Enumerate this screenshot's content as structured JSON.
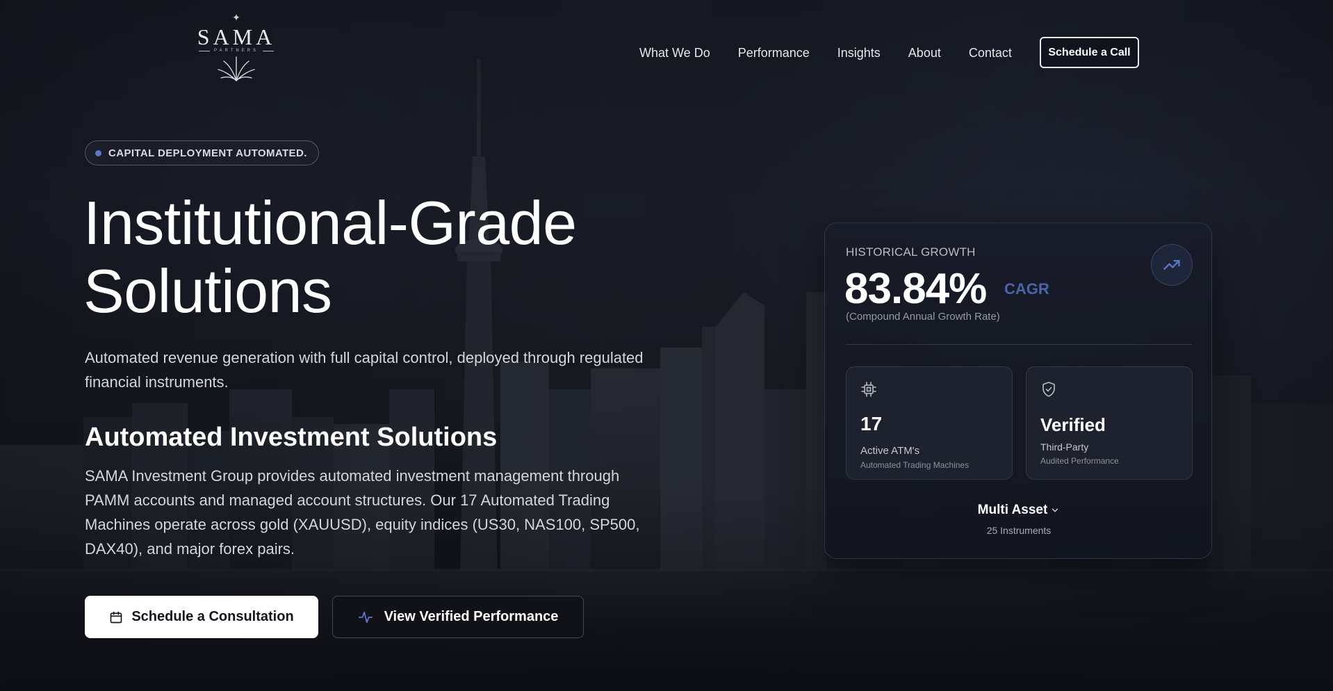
{
  "brand": {
    "name": "SAMA",
    "tagline": "PARTNERS"
  },
  "nav": {
    "items": [
      {
        "label": "What We Do"
      },
      {
        "label": "Performance"
      },
      {
        "label": "Insights"
      },
      {
        "label": "About"
      },
      {
        "label": "Contact"
      }
    ],
    "cta_label": "Schedule a Call"
  },
  "hero": {
    "badge": "CAPITAL DEPLOYMENT AUTOMATED.",
    "title_line1": "Institutional-Grade",
    "title_line2": "Solutions",
    "lead": "Automated revenue generation with full capital control, deployed through regulated financial instruments.",
    "section_title": "Automated Investment Solutions",
    "section_body": "SAMA Investment Group provides automated investment management through PAMM accounts and managed account structures. Our 17 Automated Trading Machines operate across gold (XAUUSD), equity indices (US30, NAS100, SP500, DAX40), and major forex pairs.",
    "primary_button": "Schedule a Consultation",
    "secondary_button": "View Verified Performance"
  },
  "stats_card": {
    "kicker": "HISTORICAL GROWTH",
    "metric": "83.84%",
    "metric_unit": "CAGR",
    "note": "(Compound Annual Growth Rate)",
    "tiles": [
      {
        "value": "17",
        "label": "Active ATM's",
        "sub": "Automated Trading Machines",
        "icon": "chip-icon"
      },
      {
        "value": "Verified",
        "label": "Third-Party",
        "sub": "Audited Performance",
        "icon": "shield-check-icon"
      }
    ],
    "asset_selector": {
      "label": "Multi Asset",
      "count": "25 Instruments"
    }
  },
  "colors": {
    "accent": "#4b64a8",
    "badge_dot": "#5a77c9",
    "background": "#11141c"
  }
}
